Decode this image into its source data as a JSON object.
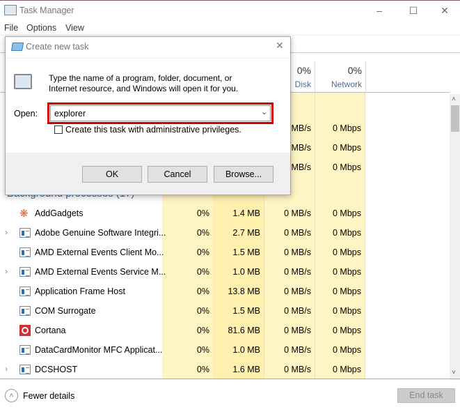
{
  "window": {
    "title": "Task Manager",
    "menu": [
      "File",
      "Options",
      "View"
    ],
    "minimize_icon": "minimize-icon",
    "maximize_icon": "maximize-icon",
    "close_icon": "close-icon"
  },
  "columns": [
    {
      "pct": "",
      "label": ""
    },
    {
      "pct": "",
      "label": ""
    },
    {
      "pct": "0%",
      "label": "Disk"
    },
    {
      "pct": "0%",
      "label": "Network"
    }
  ],
  "partial_rows": [
    {
      "disk": "MB/s",
      "network": "0 Mbps"
    },
    {
      "disk": "MB/s",
      "network": "0 Mbps"
    },
    {
      "disk": "MB/s",
      "network": "0 Mbps"
    }
  ],
  "group_header": "Background processes (17)",
  "rows": [
    {
      "name": "AddGadgets",
      "cpu": "0%",
      "memory": "1.4 MB",
      "disk": "0 MB/s",
      "network": "0 Mbps",
      "expandable": false,
      "icon": "addgadgets-icon"
    },
    {
      "name": "Adobe Genuine Software Integri...",
      "cpu": "0%",
      "memory": "2.7 MB",
      "disk": "0 MB/s",
      "network": "0 Mbps",
      "expandable": true,
      "icon": "app-window-icon"
    },
    {
      "name": "AMD External Events Client Mo...",
      "cpu": "0%",
      "memory": "1.5 MB",
      "disk": "0 MB/s",
      "network": "0 Mbps",
      "expandable": false,
      "icon": "app-window-icon"
    },
    {
      "name": "AMD External Events Service M...",
      "cpu": "0%",
      "memory": "1.0 MB",
      "disk": "0 MB/s",
      "network": "0 Mbps",
      "expandable": true,
      "icon": "app-window-icon"
    },
    {
      "name": "Application Frame Host",
      "cpu": "0%",
      "memory": "13.8 MB",
      "disk": "0 MB/s",
      "network": "0 Mbps",
      "expandable": false,
      "icon": "app-window-icon"
    },
    {
      "name": "COM Surrogate",
      "cpu": "0%",
      "memory": "1.5 MB",
      "disk": "0 MB/s",
      "network": "0 Mbps",
      "expandable": false,
      "icon": "app-window-icon"
    },
    {
      "name": "Cortana",
      "cpu": "0%",
      "memory": "81.6 MB",
      "disk": "0 MB/s",
      "network": "0 Mbps",
      "expandable": false,
      "icon": "cortana-icon"
    },
    {
      "name": "DataCardMonitor MFC Applicat...",
      "cpu": "0%",
      "memory": "1.0 MB",
      "disk": "0 MB/s",
      "network": "0 Mbps",
      "expandable": false,
      "icon": "app-window-icon"
    },
    {
      "name": "DCSHOST",
      "cpu": "0%",
      "memory": "1.6 MB",
      "disk": "0 MB/s",
      "network": "0 Mbps",
      "expandable": true,
      "icon": "app-window-icon"
    }
  ],
  "footer": {
    "fewer_details": "Fewer details",
    "end_task": "End task"
  },
  "dialog": {
    "title": "Create new task",
    "description": "Type the name of a program, folder, document, or Internet resource, and Windows will open it for you.",
    "open_label": "Open:",
    "open_value": "explorer",
    "checkbox_label": "Create this task with administrative privileges.",
    "checkbox_checked": false,
    "ok": "OK",
    "cancel": "Cancel",
    "browse": "Browse..."
  },
  "colors": {
    "highlight": "#cc0000",
    "cpu_col": "#fff4c4",
    "mem_col": "#fff0b0",
    "link": "#2f6aa8"
  }
}
